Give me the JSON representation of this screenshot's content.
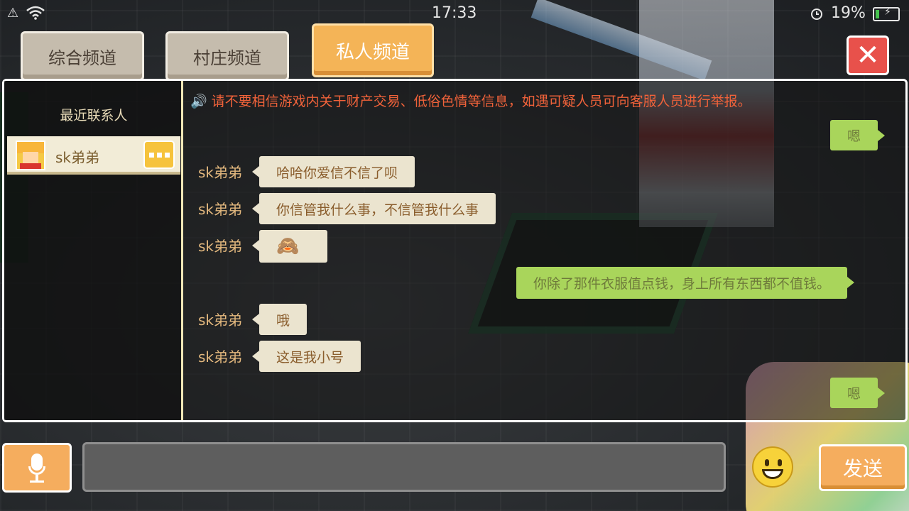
{
  "status_bar": {
    "time": "17:33",
    "battery_percent": "19%",
    "battery_level": 0.19,
    "icons": [
      "notification-icon",
      "wifi-icon",
      "alarm-icon",
      "battery-charging-icon"
    ]
  },
  "tabs": [
    {
      "label": "综合频道",
      "active": false
    },
    {
      "label": "村庄频道",
      "active": false
    },
    {
      "label": "私人频道",
      "active": true
    }
  ],
  "close_icon": "✕",
  "sidebar": {
    "title": "最近联系人",
    "contacts": [
      {
        "name": "sk弟弟"
      }
    ]
  },
  "notice": {
    "icon": "🔊",
    "text": "请不要相信游戏内关于财产交易、低俗色情等信息，如遇可疑人员可向客服人员进行举报。"
  },
  "messages": [
    {
      "from": "me",
      "text": "嗯"
    },
    {
      "from": "sk弟弟",
      "text": "哈哈你爱信不信了呗"
    },
    {
      "from": "sk弟弟",
      "text": "你信管我什么事，不信管我什么事"
    },
    {
      "from": "sk弟弟",
      "text": "🙈"
    },
    {
      "from": "me",
      "text": "你除了那件衣服值点钱，身上所有东西都不值钱。"
    },
    {
      "from": "sk弟弟",
      "text": "哦"
    },
    {
      "from": "sk弟弟",
      "text": "这是我小号"
    },
    {
      "from": "me",
      "text": "嗯"
    }
  ],
  "composer": {
    "input_value": "",
    "send_label": "发送"
  },
  "colors": {
    "tab_active": "#f4b457",
    "tab_inactive": "#c5bcad",
    "bubble_in": "#ebe4cf",
    "bubble_out": "#a9d55b",
    "close": "#e8514b",
    "notice": "#f0623a"
  }
}
